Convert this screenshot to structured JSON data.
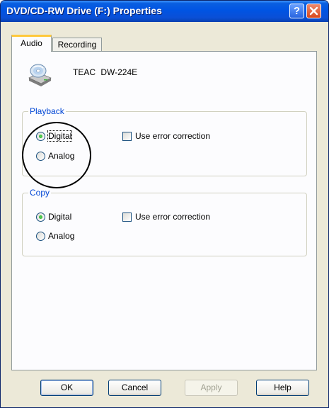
{
  "window": {
    "title": "DVD/CD-RW Drive (F:) Properties"
  },
  "titlebar_buttons": {
    "help": "?",
    "close_icon": "close-icon"
  },
  "tabs": [
    {
      "label": "Audio",
      "active": true
    },
    {
      "label": "Recording",
      "active": false
    }
  ],
  "device": {
    "icon": "cd-drive-icon",
    "name": "TEAC   DW-224E"
  },
  "playback": {
    "label": "Playback",
    "digital": "Digital",
    "analog": "Analog",
    "selected": "Digital",
    "error_correction": "Use error correction",
    "error_correction_checked": false
  },
  "copy": {
    "label": "Copy",
    "digital": "Digital",
    "analog": "Analog",
    "selected": "Digital",
    "error_correction": "Use error correction",
    "error_correction_checked": false
  },
  "buttons": {
    "ok": "OK",
    "cancel": "Cancel",
    "apply": "Apply",
    "help": "Help"
  },
  "colors": {
    "title_bar": "#0054e3",
    "group_label": "#0046d5",
    "radio_selected": "#21a121"
  }
}
